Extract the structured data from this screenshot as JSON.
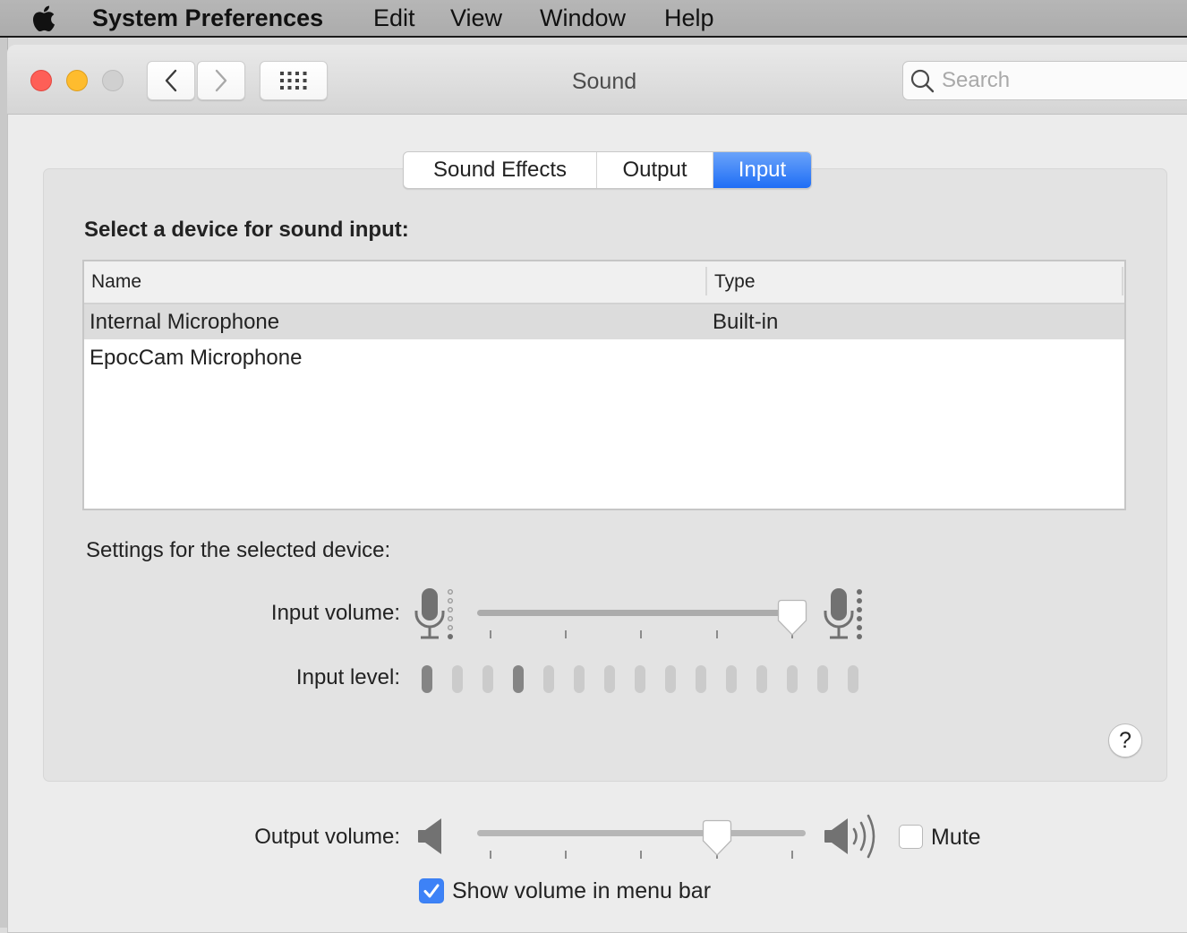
{
  "menubar": {
    "app_name": "System Preferences",
    "items": [
      "Edit",
      "View",
      "Window",
      "Help"
    ]
  },
  "window": {
    "title": "Sound",
    "search_placeholder": "Search",
    "search_value": ""
  },
  "tabs": [
    {
      "label": "Sound Effects",
      "selected": false
    },
    {
      "label": "Output",
      "selected": false
    },
    {
      "label": "Input",
      "selected": true
    }
  ],
  "input_pane": {
    "heading": "Select a device for sound input:",
    "table": {
      "columns": [
        "Name",
        "Type"
      ],
      "rows": [
        {
          "name": "Internal Microphone",
          "type": "Built-in",
          "selected": true
        },
        {
          "name": "EpocCam Microphone",
          "type": "",
          "selected": false
        }
      ]
    },
    "settings_heading": "Settings for the selected device:",
    "input_volume": {
      "label": "Input volume:",
      "value": 1.0
    },
    "input_level": {
      "label": "Input level:",
      "segments": 15,
      "lit_segments": [
        1,
        4
      ]
    },
    "help_label": "?"
  },
  "output_volume": {
    "label": "Output volume:",
    "value": 0.75
  },
  "mute": {
    "label": "Mute",
    "checked": false
  },
  "show_volume": {
    "label": "Show volume in menu bar",
    "checked": true
  },
  "colors": {
    "accent": "#2f7af6",
    "close": "#fe5f57",
    "minimize": "#febc2e",
    "zoom_disabled": "#d0d0d0",
    "level_lit": "#858585",
    "level_unlit": "#cbcbcb"
  }
}
